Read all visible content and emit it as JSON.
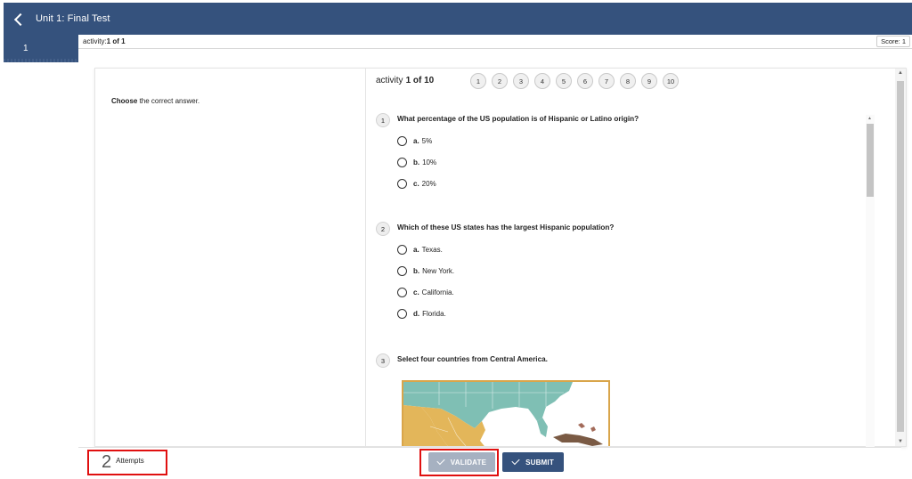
{
  "header": {
    "title": "Unit 1: Final Test"
  },
  "side_tab": {
    "label": "1"
  },
  "activity_bar": {
    "prefix": "activity: ",
    "value": "1 of 1",
    "score": "Score: 1"
  },
  "instruction": {
    "bold": "Choose",
    "rest": " the correct answer."
  },
  "activity_header": {
    "prefix": "activity",
    "value": "1 of 10"
  },
  "pager": [
    "1",
    "2",
    "3",
    "4",
    "5",
    "6",
    "7",
    "8",
    "9",
    "10"
  ],
  "questions": [
    {
      "num": "1",
      "text": "What percentage of the US population is of Hispanic or Latino origin?",
      "options": [
        {
          "letter": "a.",
          "text": "5%"
        },
        {
          "letter": "b.",
          "text": "10%"
        },
        {
          "letter": "c.",
          "text": "20%"
        }
      ]
    },
    {
      "num": "2",
      "text": "Which of these US states has the largest Hispanic population?",
      "options": [
        {
          "letter": "a.",
          "text": "Texas."
        },
        {
          "letter": "b.",
          "text": "New York."
        },
        {
          "letter": "c.",
          "text": "California."
        },
        {
          "letter": "d.",
          "text": "Florida."
        }
      ]
    },
    {
      "num": "3",
      "text": "Select four countries from Central America.",
      "options": []
    }
  ],
  "footer": {
    "attempts_count": "2",
    "attempts_label": "Attempts",
    "validate_label": "VALIDATE",
    "submit_label": "SUBMIT"
  },
  "colors": {
    "brand": "#35527d",
    "validate_disabled": "#a6b1c1",
    "highlight": "#e01010",
    "map_border": "#d9a54a"
  }
}
